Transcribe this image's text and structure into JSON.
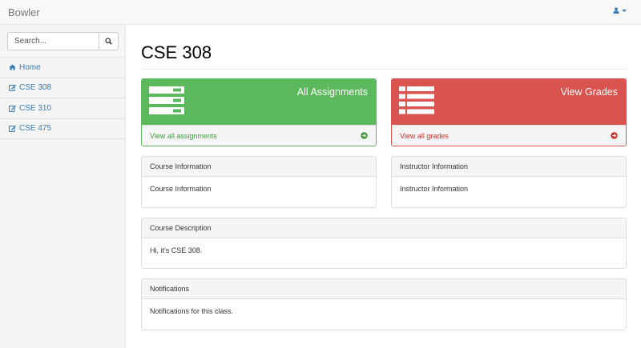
{
  "navbar": {
    "brand": "Bowler",
    "user_icon": "user-icon"
  },
  "sidebar": {
    "search": {
      "placeholder": "Search...",
      "icon": "search-icon"
    },
    "items": [
      {
        "label": "Home",
        "icon": "home-icon"
      },
      {
        "label": "CSE 308",
        "icon": "edit-icon"
      },
      {
        "label": "CSE 310",
        "icon": "edit-icon"
      },
      {
        "label": "CSE 475",
        "icon": "edit-icon"
      }
    ]
  },
  "main": {
    "title": "CSE 308",
    "assignments": {
      "title": "All Assignments",
      "link": "View all assignments",
      "color": "#5cb85c"
    },
    "grades": {
      "title": "View Grades",
      "link": "View all grades",
      "color": "#d9534f"
    },
    "course_info": {
      "heading": "Course Information",
      "body": "Course Information"
    },
    "instructor_info": {
      "heading": "Instructor Information",
      "body": "Instructor Information"
    },
    "course_description": {
      "heading": "Course Description",
      "body": "Hi, it's CSE 308."
    },
    "notifications": {
      "heading": "Notifications",
      "body": "Notifications for this class."
    }
  }
}
